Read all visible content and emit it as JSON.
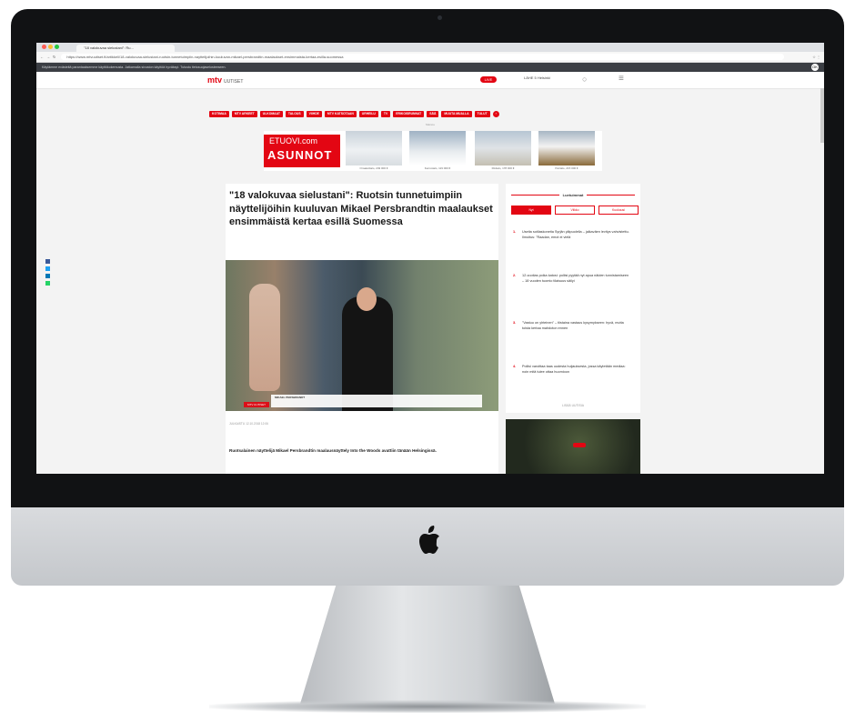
{
  "browser": {
    "tab_title": "\"18 valokuvaa sielustani\": Ru...",
    "url": "https://www.mtvuutiset.fi/artikkeli/18-valokuvaa-sielustani-ruotsin-tunnetuimpiin-nayttelijoihin-kuuluvan-mikael-persbrandtin-maalaukset-ensimmaista-kertaa-esilla-suomessa",
    "cookie_notice": "Käytämme evästeitä parantaaksemme käyttökokemusta. Jatkamalla sivuston käyttöä hyväksyt. Tutustu tietosuojaselosteeseen.",
    "cookie_ok": "OK"
  },
  "site": {
    "logo": "mtv",
    "logo_sub": "UUTISET",
    "live_label": "LIVE",
    "weather": "LÄHE 5 Helsinki",
    "nav": [
      "KOTIMAA",
      "MTV ARKEET",
      "ULKOMAAT",
      "TALOUS",
      "VIIHDE",
      "MTV KATSOTAAN",
      "URHEILU",
      "TV",
      "ERIKOISRUNNAT",
      "SÄÄ",
      "MUUTA MUALLA",
      "TULUT"
    ]
  },
  "ad": {
    "label": "Mainos",
    "brand_top": "ETUOVI.com",
    "brand_main": "ASUNNOT",
    "captions": [
      "Omakotitalo, 249 000 €",
      "Kerrostalo, 119 000 €",
      "Rivitalo, 178 000 €",
      "Paritalo, 215 000 €"
    ]
  },
  "article": {
    "title": "\"18 valokuvaa sielustani\": Ruotsin tunnetuimpiin näyttelijöihin kuuluvan Mikael Persbrandtin maalaukset ensimmäistä kertaa esillä Suomessa",
    "lower_third_name": "MIKAEL PERSBRANDT",
    "lower_third_tag": "MTV UUTISET",
    "meta": "JULKAISTU 12.10.2018 12:06",
    "lead": "Ruotsalainen näyttelijä Mikael Persbrandtin maalausnäyttely Into the Woods avattiin tänään Helsingissä."
  },
  "sidebar": {
    "heading": "Luetuimmat",
    "tabs": [
      "Nyt",
      "Viikko",
      "Kuukausi"
    ],
    "items": [
      {
        "num": "1.",
        "text": "Useita sotilaskoneita Syrjän yläpuolella – jalkaväen levitys vahvistettu. Ilmoitus: \"Raadan, emot ei vielä"
      },
      {
        "num": "2.",
        "text": "12-vuotias poika katosi: poliisi pyytää nyt apua näiden tunnistamiseen – 18 vuoden tuomio tilaisuus säilyi"
      },
      {
        "num": "3.",
        "text": "\"Vastuu on yhteinen\" – tiistaina vastaus kysymykseen: hyvä, mutta toista kertaa mahdoton ennen"
      },
      {
        "num": "4.",
        "text": "Poliisi varoittaa taas uudesta huijauksesta, jossa käytetään mediaa: noin mitä tulee ottaa huomioon"
      }
    ],
    "more": "LISÄÄ UUTISIA"
  },
  "colors": {
    "brand_red": "#e30613",
    "screen_bg": "#f3f3f3"
  }
}
